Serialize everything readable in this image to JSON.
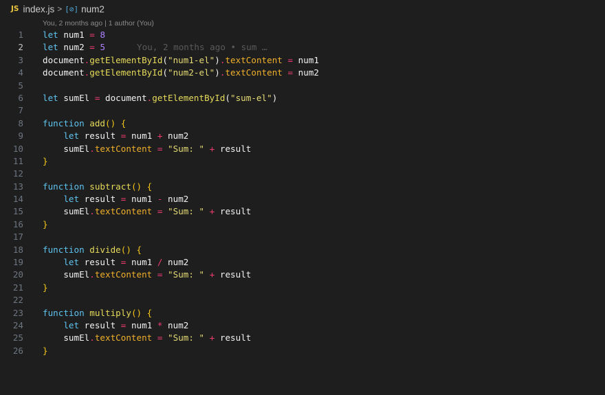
{
  "breadcrumb": {
    "file_icon": "JS",
    "file_name": "index.js",
    "separator": ">",
    "symbol_icon": "[⊘]",
    "symbol_name": "num2"
  },
  "codelens": "You, 2 months ago | 1 author (You)",
  "active_line": 2,
  "inline_blame": "You, 2 months ago • sum …",
  "lines": [
    {
      "n": "1",
      "t": [
        [
          "kw",
          "let"
        ],
        [
          "var",
          " num1 "
        ],
        [
          "op",
          "="
        ],
        [
          "var",
          " "
        ],
        [
          "num",
          "8"
        ]
      ]
    },
    {
      "n": "2",
      "t": [
        [
          "kw",
          "let"
        ],
        [
          "var",
          " num2 "
        ],
        [
          "op",
          "="
        ],
        [
          "var",
          " "
        ],
        [
          "num",
          "5"
        ]
      ]
    },
    {
      "n": "3",
      "t": [
        [
          "var",
          "document"
        ],
        [
          "op",
          "."
        ],
        [
          "fn",
          "getElementById"
        ],
        [
          "punc",
          "("
        ],
        [
          "str",
          "\"num1-el\""
        ],
        [
          "punc",
          ")"
        ],
        [
          "op",
          "."
        ],
        [
          "prop",
          "textContent"
        ],
        [
          "var",
          " "
        ],
        [
          "op",
          "="
        ],
        [
          "var",
          " num1"
        ]
      ]
    },
    {
      "n": "4",
      "t": [
        [
          "var",
          "document"
        ],
        [
          "op",
          "."
        ],
        [
          "fn",
          "getElementById"
        ],
        [
          "punc",
          "("
        ],
        [
          "str",
          "\"num2-el\""
        ],
        [
          "punc",
          ")"
        ],
        [
          "op",
          "."
        ],
        [
          "prop",
          "textContent"
        ],
        [
          "var",
          " "
        ],
        [
          "op",
          "="
        ],
        [
          "var",
          " num2"
        ]
      ]
    },
    {
      "n": "5",
      "t": []
    },
    {
      "n": "6",
      "t": [
        [
          "kw",
          "let"
        ],
        [
          "var",
          " sumEl "
        ],
        [
          "op",
          "="
        ],
        [
          "var",
          " document"
        ],
        [
          "op",
          "."
        ],
        [
          "fn",
          "getElementById"
        ],
        [
          "punc",
          "("
        ],
        [
          "str",
          "\"sum-el\""
        ],
        [
          "punc",
          ")"
        ]
      ]
    },
    {
      "n": "7",
      "t": []
    },
    {
      "n": "8",
      "t": [
        [
          "kw",
          "function"
        ],
        [
          "var",
          " "
        ],
        [
          "fn",
          "add"
        ],
        [
          "brace",
          "() {"
        ]
      ]
    },
    {
      "n": "9",
      "t": [
        [
          "var",
          "    "
        ],
        [
          "kw",
          "let"
        ],
        [
          "var",
          " result "
        ],
        [
          "op",
          "="
        ],
        [
          "var",
          " num1 "
        ],
        [
          "op",
          "+"
        ],
        [
          "var",
          " num2"
        ]
      ]
    },
    {
      "n": "10",
      "t": [
        [
          "var",
          "    sumEl"
        ],
        [
          "op",
          "."
        ],
        [
          "prop",
          "textContent"
        ],
        [
          "var",
          " "
        ],
        [
          "op",
          "="
        ],
        [
          "var",
          " "
        ],
        [
          "str",
          "\"Sum: \""
        ],
        [
          "var",
          " "
        ],
        [
          "op",
          "+"
        ],
        [
          "var",
          " result"
        ]
      ]
    },
    {
      "n": "11",
      "t": [
        [
          "brace",
          "}"
        ]
      ]
    },
    {
      "n": "12",
      "t": []
    },
    {
      "n": "13",
      "t": [
        [
          "kw",
          "function"
        ],
        [
          "var",
          " "
        ],
        [
          "fn",
          "subtract"
        ],
        [
          "brace",
          "() {"
        ]
      ]
    },
    {
      "n": "14",
      "t": [
        [
          "var",
          "    "
        ],
        [
          "kw",
          "let"
        ],
        [
          "var",
          " result "
        ],
        [
          "op",
          "="
        ],
        [
          "var",
          " num1 "
        ],
        [
          "op",
          "-"
        ],
        [
          "var",
          " num2"
        ]
      ]
    },
    {
      "n": "15",
      "t": [
        [
          "var",
          "    sumEl"
        ],
        [
          "op",
          "."
        ],
        [
          "prop",
          "textContent"
        ],
        [
          "var",
          " "
        ],
        [
          "op",
          "="
        ],
        [
          "var",
          " "
        ],
        [
          "str",
          "\"Sum: \""
        ],
        [
          "var",
          " "
        ],
        [
          "op",
          "+"
        ],
        [
          "var",
          " result"
        ]
      ]
    },
    {
      "n": "16",
      "t": [
        [
          "brace",
          "}"
        ]
      ]
    },
    {
      "n": "17",
      "t": []
    },
    {
      "n": "18",
      "t": [
        [
          "kw",
          "function"
        ],
        [
          "var",
          " "
        ],
        [
          "fn",
          "divide"
        ],
        [
          "brace",
          "() {"
        ]
      ]
    },
    {
      "n": "19",
      "t": [
        [
          "var",
          "    "
        ],
        [
          "kw",
          "let"
        ],
        [
          "var",
          " result "
        ],
        [
          "op",
          "="
        ],
        [
          "var",
          " num1 "
        ],
        [
          "op",
          "/"
        ],
        [
          "var",
          " num2"
        ]
      ]
    },
    {
      "n": "20",
      "t": [
        [
          "var",
          "    sumEl"
        ],
        [
          "op",
          "."
        ],
        [
          "prop",
          "textContent"
        ],
        [
          "var",
          " "
        ],
        [
          "op",
          "="
        ],
        [
          "var",
          " "
        ],
        [
          "str",
          "\"Sum: \""
        ],
        [
          "var",
          " "
        ],
        [
          "op",
          "+"
        ],
        [
          "var",
          " result"
        ]
      ]
    },
    {
      "n": "21",
      "t": [
        [
          "brace",
          "}"
        ]
      ]
    },
    {
      "n": "22",
      "t": []
    },
    {
      "n": "23",
      "t": [
        [
          "kw",
          "function"
        ],
        [
          "var",
          " "
        ],
        [
          "fn",
          "multiply"
        ],
        [
          "brace",
          "() {"
        ]
      ]
    },
    {
      "n": "24",
      "t": [
        [
          "var",
          "    "
        ],
        [
          "kw",
          "let"
        ],
        [
          "var",
          " result "
        ],
        [
          "op",
          "="
        ],
        [
          "var",
          " num1 "
        ],
        [
          "op",
          "*"
        ],
        [
          "var",
          " num2"
        ]
      ]
    },
    {
      "n": "25",
      "t": [
        [
          "var",
          "    sumEl"
        ],
        [
          "op",
          "."
        ],
        [
          "prop",
          "textContent"
        ],
        [
          "var",
          " "
        ],
        [
          "op",
          "="
        ],
        [
          "var",
          " "
        ],
        [
          "str",
          "\"Sum: \""
        ],
        [
          "var",
          " "
        ],
        [
          "op",
          "+"
        ],
        [
          "var",
          " result"
        ]
      ]
    },
    {
      "n": "26",
      "t": [
        [
          "brace",
          "}"
        ]
      ]
    }
  ]
}
